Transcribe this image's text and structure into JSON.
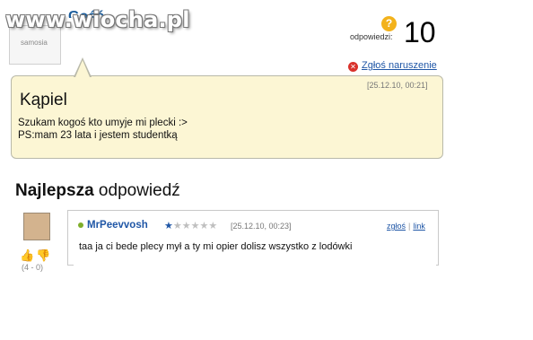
{
  "watermark": "www.wiocha.pl",
  "question": {
    "author": "Gość",
    "avatar_text": "samosia",
    "answers_label": "odpowiedzi:",
    "answers_count": "10",
    "report_label": "Zgłoś naruszenie",
    "timestamp": "[25.12.10, 00:21]",
    "title": "Kąpiel",
    "body_line_1": "Szukam kogoś kto umyje mi plecki :>",
    "body_line_2": "PS:mam 23 lata i jestem studentką"
  },
  "best_answer": {
    "heading_bold": "Najlepsza",
    "heading_rest": " odpowiedź",
    "author": "MrPeevvosh",
    "rating_stars": 1,
    "stars_text": "★★★★★★",
    "timestamp": "[25.12.10, 00:23]",
    "report_link": "zgłoś",
    "link_label": "link",
    "vote_score": "(4 - 0)",
    "text": "taa ja ci bede plecy mył a ty mi opier dolisz wszystko z lodówki"
  },
  "colors": {
    "link": "#1f56a6",
    "bubble": "#fcf6d4",
    "online": "#7fae2a"
  },
  "icons": [
    "question-mark-icon",
    "report-icon",
    "thumbs-up-icon",
    "thumbs-down-icon",
    "online-dot-icon",
    "star-icon"
  ]
}
